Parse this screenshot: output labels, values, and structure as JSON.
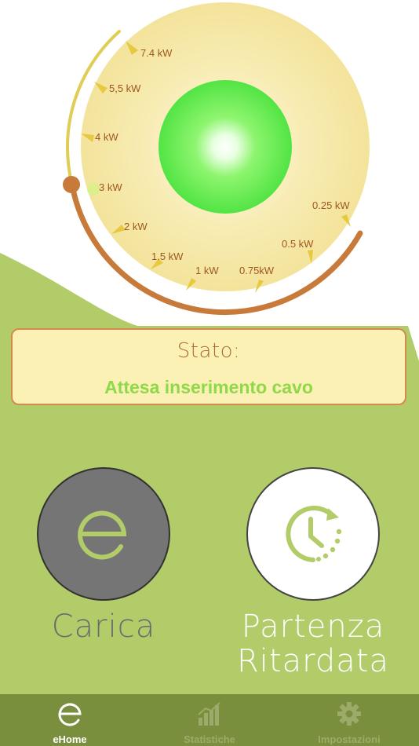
{
  "colors": {
    "green_area": "#b2cc6a",
    "tab_bar": "#7a8f3e",
    "tab_active": "#ffffff",
    "tab_inactive": "#9cab6a",
    "gauge_fill": "#f5e6a2",
    "arc_active": "#c87a3a",
    "arc_inactive": "#e0cd56",
    "orb": "#5cf04c",
    "status_text": "#8fd84a"
  },
  "gauge": {
    "labels": [
      "7.4 kW",
      "5,5 kW",
      "4 kW",
      "3 kW",
      "2 kW",
      "1.5 kW",
      "1 kW",
      "0.75kW",
      "0.5 kW",
      "0.25 kW"
    ],
    "selected": "3 kW"
  },
  "status": {
    "label": "Stato:",
    "value": "Attesa inserimento cavo"
  },
  "buttons": {
    "charge_label": "Carica",
    "charge_icon": "e-logo-icon",
    "delay_label_line1": "Partenza",
    "delay_label_line2": "Ritardata",
    "delay_icon": "clock-delay-icon"
  },
  "tabbar": {
    "items": [
      {
        "label": "eHome",
        "icon": "e-logo-icon",
        "active": true
      },
      {
        "label": "Statistiche",
        "icon": "chart-icon",
        "active": false
      },
      {
        "label": "Impostazioni",
        "icon": "gear-icon",
        "active": false
      }
    ]
  }
}
